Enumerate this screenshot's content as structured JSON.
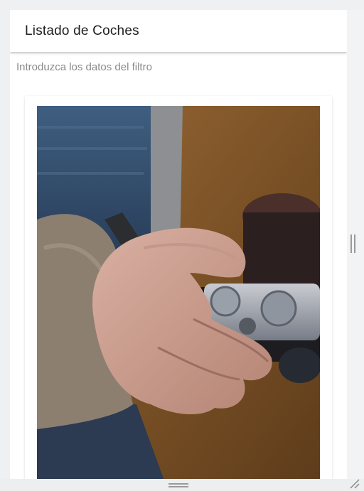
{
  "header": {
    "title": "Listado de Coches"
  },
  "filter": {
    "hint": "Introduzca los datos del filtro"
  },
  "card": {
    "image_subject": "hand-holding-camera"
  },
  "colors": {
    "background": "#eef0f2",
    "panel": "#ffffff",
    "title_text": "#212121",
    "hint_text": "#8a8a8a"
  }
}
